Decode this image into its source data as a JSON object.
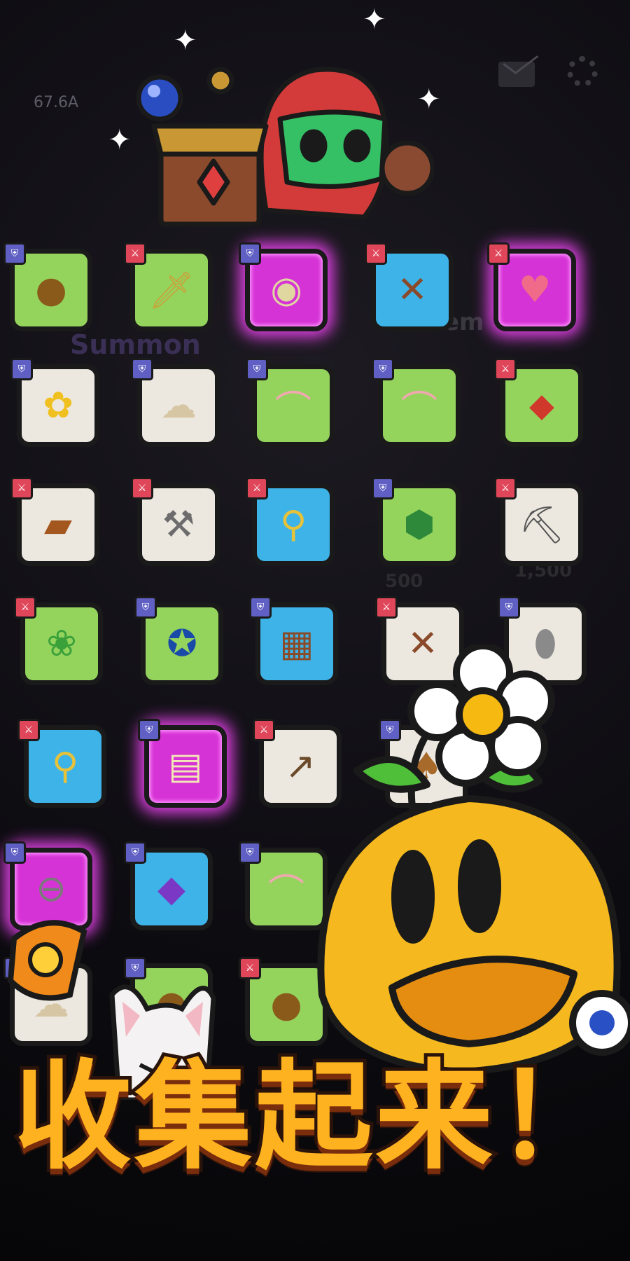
{
  "stat_value": "67.6A",
  "background_labels": {
    "summon": "Summon",
    "gem": "Gem",
    "summon_cost_1": "500",
    "summon_cost_2": "1,500"
  },
  "headline": "收集起来！",
  "colors": {
    "green_tile": "#94d45d",
    "white_tile": "#ece8e0",
    "blue_tile": "#3db3e8",
    "purple_tile": "#d633d6",
    "shield_badge": "#5f5fc4",
    "sword_badge": "#e0465a",
    "headline": "#ffb21f"
  },
  "inventory": [
    {
      "row": 0,
      "col": 0,
      "tile": "green",
      "badge": "shield",
      "icon": "coin-icon"
    },
    {
      "row": 0,
      "col": 1,
      "tile": "green",
      "badge": "sword",
      "icon": "dagger-icon"
    },
    {
      "row": 0,
      "col": 2,
      "tile": "purple",
      "badge": "shield",
      "icon": "mirror-icon"
    },
    {
      "row": 0,
      "col": 3,
      "tile": "blue",
      "badge": "sword",
      "icon": "crossbow-icon"
    },
    {
      "row": 0,
      "col": 4,
      "tile": "purple",
      "badge": "sword",
      "icon": "heart-flower-icon"
    },
    {
      "row": 1,
      "col": 0,
      "tile": "white",
      "badge": "shield",
      "icon": "flower-icon"
    },
    {
      "row": 1,
      "col": 1,
      "tile": "white",
      "badge": "shield",
      "icon": "cloud-icon"
    },
    {
      "row": 1,
      "col": 2,
      "tile": "green",
      "badge": "shield",
      "icon": "shell-icon"
    },
    {
      "row": 1,
      "col": 3,
      "tile": "green",
      "badge": "shield",
      "icon": "shell-icon"
    },
    {
      "row": 1,
      "col": 4,
      "tile": "green",
      "badge": "sword",
      "icon": "spear-icon"
    },
    {
      "row": 2,
      "col": 0,
      "tile": "white",
      "badge": "sword",
      "icon": "club-icon"
    },
    {
      "row": 2,
      "col": 1,
      "tile": "white",
      "badge": "sword",
      "icon": "axe-icon"
    },
    {
      "row": 2,
      "col": 2,
      "tile": "blue",
      "badge": "sword",
      "icon": "magnifier-wand-icon"
    },
    {
      "row": 2,
      "col": 3,
      "tile": "green",
      "badge": "shield",
      "icon": "turtle-shell-icon"
    },
    {
      "row": 2,
      "col": 4,
      "tile": "white",
      "badge": "sword",
      "icon": "pickaxe-icon"
    },
    {
      "row": 3,
      "col": 0,
      "tile": "green",
      "badge": "sword",
      "icon": "flower-staff-icon"
    },
    {
      "row": 3,
      "col": 1,
      "tile": "green",
      "badge": "shield",
      "icon": "star-ring-icon"
    },
    {
      "row": 3,
      "col": 2,
      "tile": "blue",
      "badge": "shield",
      "icon": "wooden-shield-icon"
    },
    {
      "row": 3,
      "col": 3,
      "tile": "white",
      "badge": "sword",
      "icon": "crossbow-icon"
    },
    {
      "row": 3,
      "col": 4,
      "tile": "white",
      "badge": "shield",
      "icon": "stone-icon"
    },
    {
      "row": 4,
      "col": 0,
      "tile": "blue",
      "badge": "sword",
      "icon": "magnifier-wand-icon"
    },
    {
      "row": 4,
      "col": 1,
      "tile": "purple",
      "badge": "shield",
      "icon": "armor-icon"
    },
    {
      "row": 4,
      "col": 2,
      "tile": "white",
      "badge": "sword",
      "icon": "scythe-icon"
    },
    {
      "row": 4,
      "col": 3,
      "tile": "white",
      "badge": "shield",
      "icon": "acorn-icon"
    },
    {
      "row": 5,
      "col": 0,
      "tile": "purple",
      "badge": "shield",
      "icon": "pan-icon"
    },
    {
      "row": 5,
      "col": 1,
      "tile": "blue",
      "badge": "shield",
      "icon": "gem-chest-icon"
    },
    {
      "row": 5,
      "col": 2,
      "tile": "green",
      "badge": "shield",
      "icon": "shell-icon"
    },
    {
      "row": 6,
      "col": 0,
      "tile": "white",
      "badge": "shield",
      "icon": "cloud-icon"
    },
    {
      "row": 6,
      "col": 1,
      "tile": "green",
      "badge": "shield",
      "icon": "coin-icon"
    },
    {
      "row": 6,
      "col": 2,
      "tile": "green",
      "badge": "sword",
      "icon": "coin-icon"
    }
  ]
}
